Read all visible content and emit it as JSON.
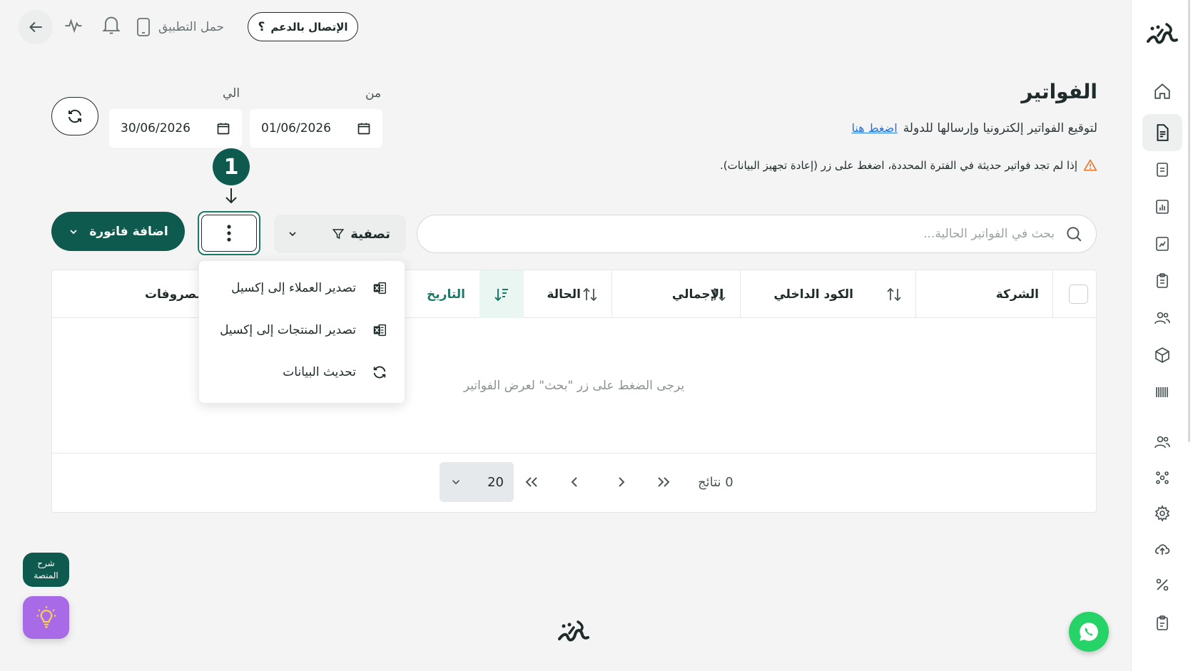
{
  "topbar": {
    "support_label": "الإتصال بالدعم",
    "app_link_label": "حمل التطبيق"
  },
  "page": {
    "title": "الفواتير",
    "subtitle": "لتوقيع الفواتير إلكترونيا وإرسالها للدولة",
    "subtitle_link": "اضغط هنا",
    "warning": "إذا لم تجد فواتير حديثة في الفترة المحددة، اضغط على زر (إعادة تجهيز البيانات)."
  },
  "dates": {
    "from_label": "من",
    "from_value": "01/06/2026",
    "to_label": "الي",
    "to_value": "30/06/2026"
  },
  "callout": {
    "number": "1"
  },
  "toolbar": {
    "search_placeholder": "بحث في الفواتير الحالية...",
    "filter_label": "تصفية",
    "add_invoice_label": "اضافة فاتورة"
  },
  "menu": {
    "items": [
      {
        "label": "تصدير العملاء إلى إكسيل",
        "icon": "excel-icon"
      },
      {
        "label": "تصدير المنتجات إلى إكسيل",
        "icon": "excel-icon"
      },
      {
        "label": "تحديث البيانات",
        "icon": "refresh-icon"
      }
    ]
  },
  "table": {
    "columns": [
      "الشركة",
      "الكود الداخلي",
      "الإجمالي",
      "الحالة",
      "التاريخ",
      "مصروفات"
    ],
    "empty_message": "يرجى الضغط على زر \"بحث\" لعرض الفواتير"
  },
  "pagination": {
    "results_label": "0 نتائج",
    "per_page": "20"
  },
  "helpers": {
    "guide_line1": "شرح",
    "guide_line2": "المنصة"
  },
  "colors": {
    "brand": "#0f5a4f",
    "accent_green": "#1b7a67",
    "whatsapp": "#25d366",
    "tip": "#a86ae6"
  }
}
